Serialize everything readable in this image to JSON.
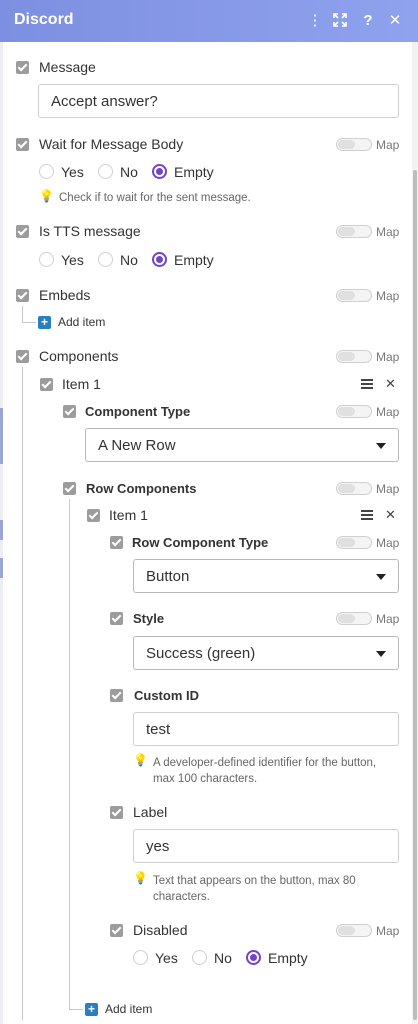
{
  "header": {
    "title": "Discord"
  },
  "common": {
    "map_label": "Map",
    "add_item": "Add item"
  },
  "message": {
    "label": "Message",
    "value": "Accept answer?"
  },
  "wait_body": {
    "label": "Wait for Message Body",
    "options": [
      "Yes",
      "No",
      "Empty"
    ],
    "selected": "Empty",
    "hint": "Check if to wait for the sent message."
  },
  "tts": {
    "label": "Is TTS message",
    "options": [
      "Yes",
      "No",
      "Empty"
    ],
    "selected": "Empty"
  },
  "embeds": {
    "label": "Embeds"
  },
  "components": {
    "label": "Components",
    "item_label": "Item 1",
    "component_type": {
      "label": "Component Type",
      "value": "A New Row"
    },
    "row_components": {
      "label": "Row Components",
      "item_label": "Item 1",
      "row_component_type": {
        "label": "Row Component Type",
        "value": "Button"
      },
      "style": {
        "label": "Style",
        "value": "Success (green)"
      },
      "custom_id": {
        "label": "Custom ID",
        "value": "test",
        "hint_line1": "A developer-defined identifier for the button,",
        "hint_line2": "max 100 characters."
      },
      "label_field": {
        "label": "Label",
        "value": "yes",
        "hint_line1": "Text that appears on the button, max 80",
        "hint_line2": "characters."
      },
      "disabled": {
        "label": "Disabled",
        "options": [
          "Yes",
          "No",
          "Empty"
        ],
        "selected": "Empty"
      }
    }
  },
  "colors": {
    "header": "#8196e8",
    "radio_selected": "#6f45c9",
    "add_icon": "#2a7fc0"
  }
}
